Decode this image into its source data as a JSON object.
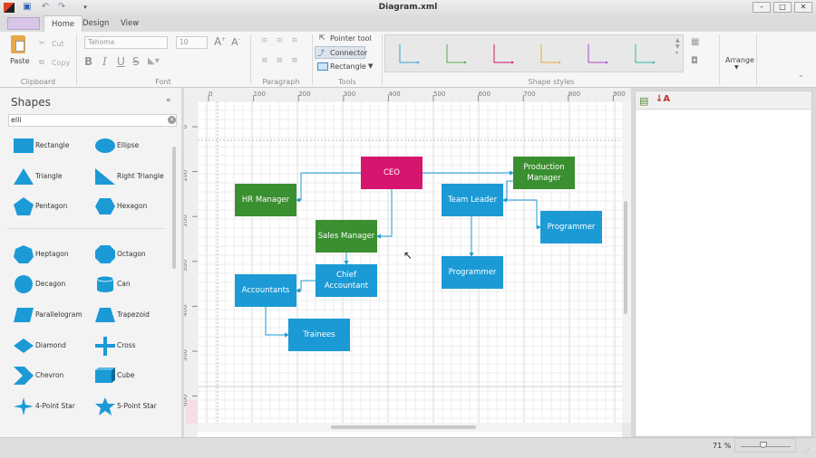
{
  "window": {
    "title": "Diagram.xml",
    "controls": [
      "minimize",
      "maximize",
      "close"
    ]
  },
  "quick_access": [
    "app-logo-icon",
    "save-icon",
    "undo-icon",
    "redo-icon",
    "customize-dropdown-icon"
  ],
  "tabs": [
    {
      "label": "Home",
      "active": true
    },
    {
      "label": "Design"
    },
    {
      "label": "View"
    }
  ],
  "ribbon": {
    "clipboard": {
      "label": "Clipboard",
      "paste": "Paste",
      "cut": "Cut",
      "copy": "Copy"
    },
    "font": {
      "label": "Font",
      "family": "Tahoma",
      "size": "10",
      "bold": "B",
      "italic": "I",
      "underline": "U",
      "strike": "S"
    },
    "paragraph": {
      "label": "Paragraph"
    },
    "tools": {
      "label": "Tools",
      "pointer": "Pointer tool",
      "connector": "Connector",
      "rectangle": "Rectangle",
      "active": "Connector"
    },
    "shape_styles": {
      "label": "Shape styles",
      "colors": [
        "#3aa0d8",
        "#5aaa55",
        "#d6156e",
        "#e8a840",
        "#a848c8",
        "#30b8a0"
      ]
    },
    "arrange": "Arrange"
  },
  "shapes_panel": {
    "title": "Shapes",
    "search_value": "elli",
    "items": [
      {
        "label": "Rectangle",
        "icon": "rectangle"
      },
      {
        "label": "Ellipse",
        "icon": "ellipse"
      },
      {
        "label": "Triangle",
        "icon": "triangle"
      },
      {
        "label": "Right Triangle",
        "icon": "right-triangle"
      },
      {
        "label": "Pentagon",
        "icon": "pentagon"
      },
      {
        "label": "Hexagon",
        "icon": "hexagon"
      },
      {
        "label": "Heptagon",
        "icon": "heptagon"
      },
      {
        "label": "Octagon",
        "icon": "octagon"
      },
      {
        "label": "Decagon",
        "icon": "decagon"
      },
      {
        "label": "Can",
        "icon": "can"
      },
      {
        "label": "Parallelogram",
        "icon": "parallelogram"
      },
      {
        "label": "Trapezoid",
        "icon": "trapezoid"
      },
      {
        "label": "Diamond",
        "icon": "diamond"
      },
      {
        "label": "Cross",
        "icon": "cross"
      },
      {
        "label": "Chevron",
        "icon": "chevron"
      },
      {
        "label": "Cube",
        "icon": "cube"
      },
      {
        "label": "4-Point Star",
        "icon": "star4"
      },
      {
        "label": "5-Point Star",
        "icon": "star5"
      }
    ]
  },
  "ruler": {
    "h": [
      "0",
      "100",
      "200",
      "300",
      "400",
      "500",
      "600",
      "700",
      "800",
      "900"
    ],
    "v": [
      "0",
      "100",
      "200",
      "300",
      "400",
      "500",
      "600"
    ]
  },
  "diagram": {
    "colors": {
      "root": "#d6156e",
      "manager": "#3a8f30",
      "staff": "#1b9ad6"
    },
    "nodes": [
      {
        "id": "ceo",
        "label": "CEO",
        "kind": "root"
      },
      {
        "id": "hr",
        "label": "HR Manager",
        "kind": "manager"
      },
      {
        "id": "sales",
        "label": "Sales Manager",
        "kind": "manager"
      },
      {
        "id": "prod",
        "label": "Production Manager",
        "kind": "manager"
      },
      {
        "id": "team",
        "label": "Team Leader",
        "kind": "staff"
      },
      {
        "id": "prog1",
        "label": "Programmer",
        "kind": "staff"
      },
      {
        "id": "prog2",
        "label": "Programmer",
        "kind": "staff"
      },
      {
        "id": "chief",
        "label": "Chief Accountant",
        "kind": "staff"
      },
      {
        "id": "acc",
        "label": "Accountants",
        "kind": "staff"
      },
      {
        "id": "train",
        "label": "Trainees",
        "kind": "staff"
      }
    ]
  },
  "status": {
    "zoom": "71 %",
    "zoom_level": 0.71
  }
}
